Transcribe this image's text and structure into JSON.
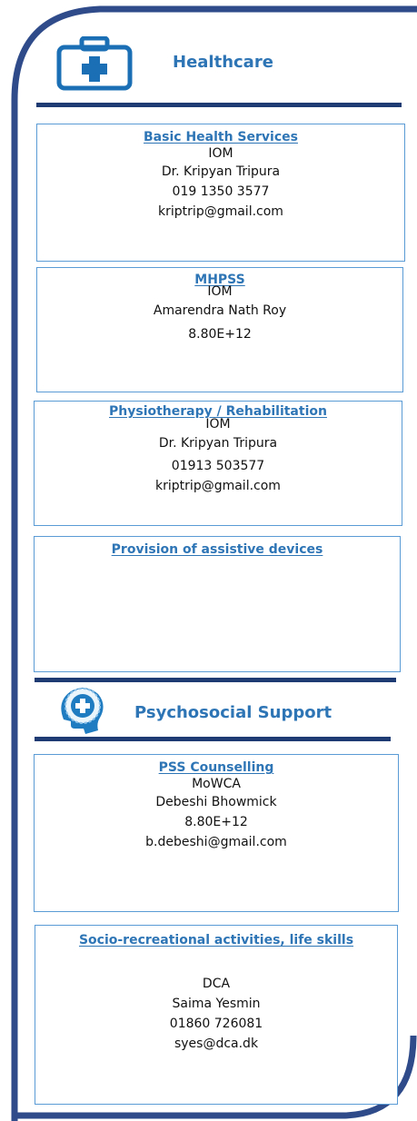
{
  "sections": [
    {
      "title": "Healthcare",
      "icon": "medical-kit-icon",
      "cards": [
        {
          "title": "Basic Health Services",
          "lines": [
            "IOM",
            "Dr. Kripyan Tripura",
            "019 1350 3577",
            "kriptrip@gmail.com"
          ]
        },
        {
          "title": "MHPSS",
          "lines": [
            "IOM",
            "Amarendra Nath Roy",
            "8.80E+12"
          ]
        },
        {
          "title": "Physiotherapy / Rehabilitation",
          "lines": [
            "IOM",
            "Dr. Kripyan Tripura",
            "01913 503577",
            "kriptrip@gmail.com"
          ]
        },
        {
          "title": "Provision of assistive devices",
          "lines": []
        }
      ]
    },
    {
      "title": "Psychosocial Support",
      "icon": "head-medical-cross-icon",
      "cards": [
        {
          "title": "PSS Counselling",
          "lines": [
            "MoWCA",
            "Debeshi Bhowmick",
            "8.80E+12",
            "b.debeshi@gmail.com"
          ]
        },
        {
          "title": "Socio-recreational activities, life skills",
          "lines": [
            "DCA",
            "Saima Yesmin",
            "01860 726081",
            "syes@dca.dk"
          ]
        }
      ]
    }
  ],
  "colors": {
    "frame": "#2f4b8a",
    "rule": "#1f3b74",
    "accent": "#2e75b6",
    "card_border": "#5b9bd5"
  }
}
